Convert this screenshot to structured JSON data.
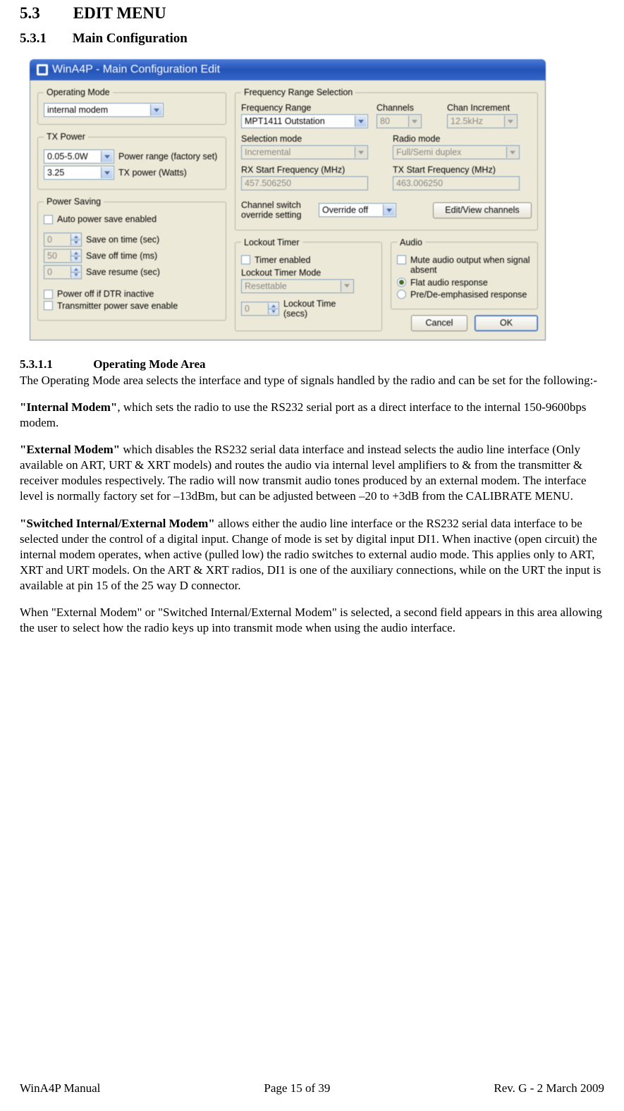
{
  "headings": {
    "sec_num": "5.3",
    "sec_title": "EDIT MENU",
    "sub_num": "5.3.1",
    "sub_title": "Main Configuration",
    "subsub_num": "5.3.1.1",
    "subsub_title": "Operating Mode Area"
  },
  "dialog": {
    "title": "WinA4P - Main Configuration Edit",
    "operating_mode": {
      "legend": "Operating Mode",
      "value": "internal modem"
    },
    "tx_power": {
      "legend": "TX Power",
      "range_value": "0.05-5.0W",
      "range_label": "Power range (factory set)",
      "watts_value": "3.25",
      "watts_label": "TX power (Watts)"
    },
    "power_saving": {
      "legend": "Power Saving",
      "auto_label": "Auto power save enabled",
      "save_on_value": "0",
      "save_on_label": "Save on time (sec)",
      "save_off_value": "50",
      "save_off_label": "Save off time (ms)",
      "save_resume_value": "0",
      "save_resume_label": "Save resume (sec)",
      "dtr_label": "Power off if DTR inactive",
      "txsave_label": "Transmitter power save enable"
    },
    "freq": {
      "legend": "Frequency Range Selection",
      "range_label": "Frequency Range",
      "range_value": "MPT1411 Outstation",
      "channels_label": "Channels",
      "channels_value": "80",
      "incr_label": "Chan Increment",
      "incr_value": "12.5kHz",
      "sel_mode_label": "Selection mode",
      "sel_mode_value": "Incremental",
      "radio_mode_label": "Radio mode",
      "radio_mode_value": "Full/Semi duplex",
      "rx_label": "RX Start Frequency (MHz)",
      "rx_value": "457.506250",
      "tx_label": "TX Start Frequency (MHz)",
      "tx_value": "463.006250",
      "switch_label": "Channel switch override setting",
      "switch_value": "Override off",
      "editview_btn": "Edit/View channels"
    },
    "lockout": {
      "legend": "Lockout Timer",
      "enabled_label": "Timer enabled",
      "mode_label": "Lockout Timer Mode",
      "mode_value": "Resettable",
      "time_value": "0",
      "time_label": "Lockout Time (secs)"
    },
    "audio": {
      "legend": "Audio",
      "mute_label": "Mute audio output when signal absent",
      "flat_label": "Flat audio response",
      "pre_label": "Pre/De-emphasised response"
    },
    "buttons": {
      "cancel": "Cancel",
      "ok": "OK"
    }
  },
  "body": {
    "p1": "The Operating Mode area selects the interface and type of signals handled by the radio and can be set for the following:-",
    "p2a": "\"Internal Modem\"",
    "p2b": ", which sets the radio to use the RS232 serial port as a direct interface to the internal 150-9600bps modem.",
    "p3a": "\"External Modem\"",
    "p3b": " which disables the RS232 serial data interface and instead selects the audio line interface (Only available on ART, URT & XRT models) and routes the audio via internal level amplifiers to & from the transmitter & receiver modules respectively.  The radio will now transmit audio tones produced by an external modem.  The interface level is normally factory set for –13dBm, but can be adjusted between –20 to +3dB from the CALIBRATE MENU.",
    "p4a": "\"Switched Internal/External Modem\"",
    "p4b": "  allows either the audio line interface or the RS232 serial data interface to be selected under the control of a digital input.  Change of mode is set by digital input DI1. When inactive (open circuit) the internal modem operates, when active (pulled low) the radio switches to external audio mode. This applies only to ART, XRT and URT models. On the ART & XRT radios, DI1 is one of the auxiliary connections, while on the URT the input is available at pin 15 of the 25 way D connector.",
    "p5": "When \"External Modem\" or \"Switched Internal/External Modem\" is selected, a second field appears in this area allowing the user to select how the radio keys up into transmit mode when using the audio interface."
  },
  "footer": {
    "left": "WinA4P Manual",
    "center": "Page 15 of 39",
    "right": "Rev. G -  2 March 2009"
  }
}
